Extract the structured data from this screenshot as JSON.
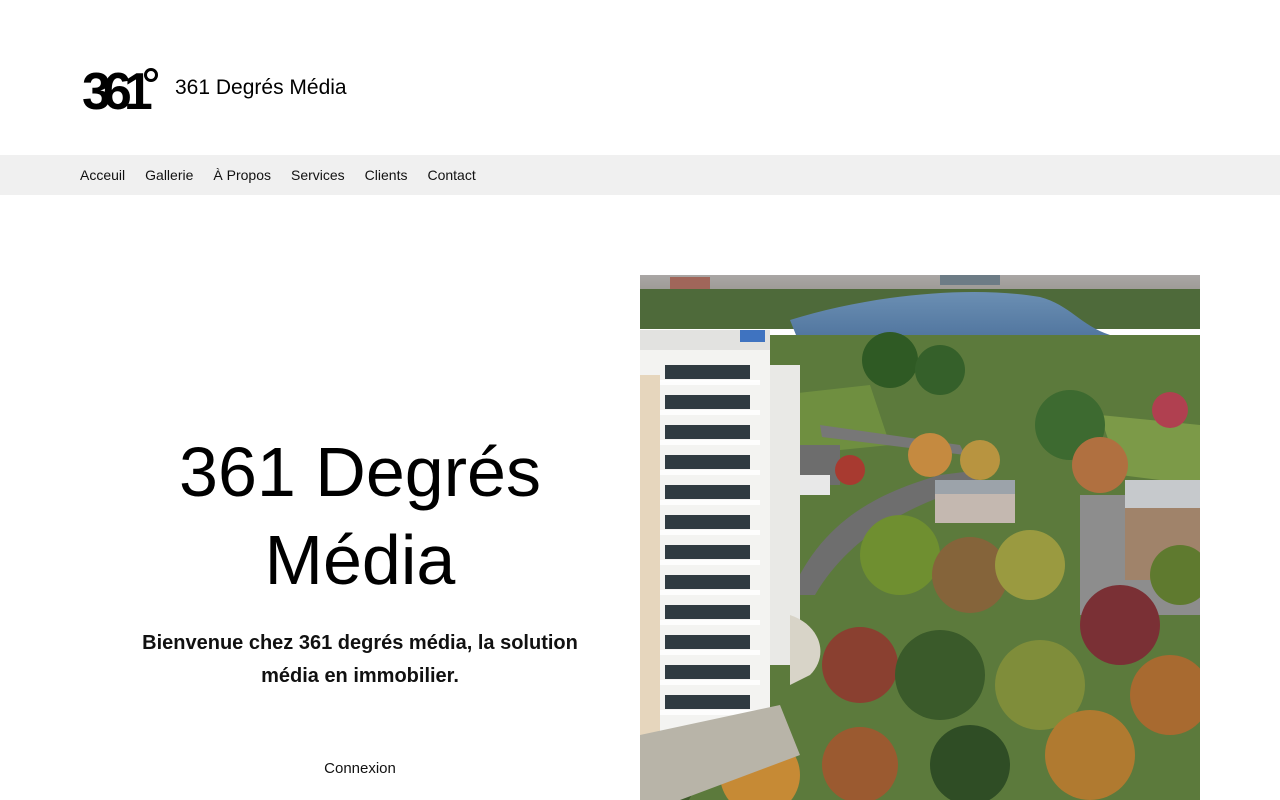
{
  "header": {
    "logo_alt": "361°",
    "site_title": "361 Degrés Média"
  },
  "nav": {
    "items": [
      {
        "label": "Acceuil"
      },
      {
        "label": "Gallerie"
      },
      {
        "label": "À Propos"
      },
      {
        "label": "Services"
      },
      {
        "label": "Clients"
      },
      {
        "label": "Contact"
      }
    ]
  },
  "hero": {
    "title_line1": "361 Degrés",
    "title_line2": "Média",
    "subtitle": "Bienvenue chez 361 degrés média, la solution média en immobilier.",
    "login_label": "Connexion"
  },
  "photo": {
    "subject": "aerial-view-condo-tower-lake-autumn-trees"
  },
  "colors": {
    "nav_bg": "#f0f0f0",
    "text": "#000000",
    "background": "#ffffff"
  }
}
